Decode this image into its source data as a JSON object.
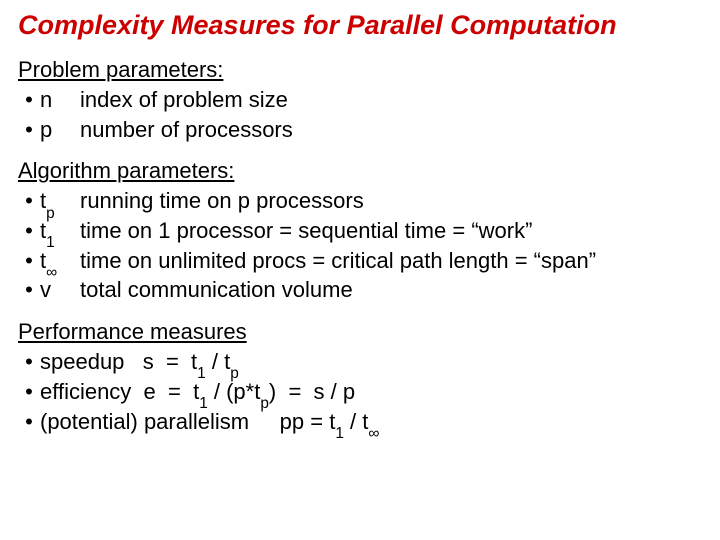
{
  "title": "Complexity Measures for Parallel Computation",
  "sections": {
    "problem": {
      "heading": "Problem parameters:",
      "items": [
        {
          "sym": "n",
          "sub": "",
          "desc": "index of problem size"
        },
        {
          "sym": "p",
          "sub": "",
          "desc": "number of processors"
        }
      ]
    },
    "algorithm": {
      "heading": "Algorithm parameters:",
      "items": [
        {
          "sym": "t",
          "sub": "p",
          "desc": "running time on p processors"
        },
        {
          "sym": "t",
          "sub": "1",
          "desc": "time on 1 processor = sequential time = “work”"
        },
        {
          "sym": "t",
          "sub": "∞",
          "desc": "time on unlimited procs = critical path length = “span”"
        },
        {
          "sym": "v",
          "sub": "",
          "desc": "total communication volume"
        }
      ]
    },
    "performance": {
      "heading": "Performance measures",
      "lines": {
        "speedup_label": "speedup   s  =  t",
        "speedup_sub1": "1",
        "speedup_mid": " / t",
        "speedup_sub2": "p",
        "efficiency_label": "efficiency  e  =  t",
        "efficiency_sub1": "1",
        "efficiency_mid": " / (p*t",
        "efficiency_sub2": "p",
        "efficiency_tail": ")  =  s / p",
        "parallel_label": "(potential) parallelism     pp = t",
        "parallel_sub1": "1",
        "parallel_mid": " / t",
        "parallel_sub2": "∞"
      }
    }
  },
  "bullet": "•"
}
